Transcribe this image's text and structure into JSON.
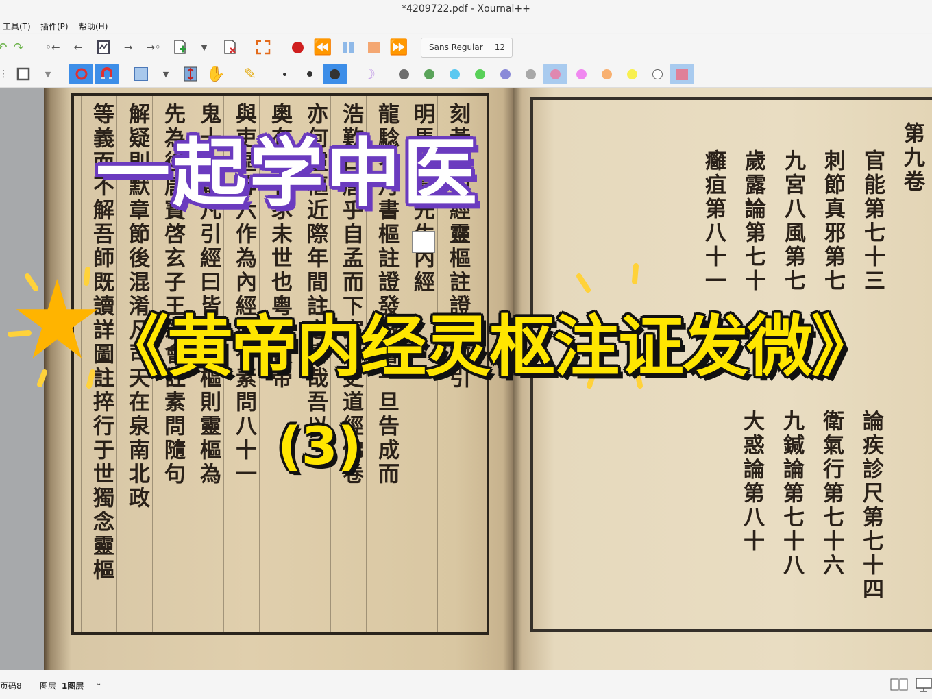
{
  "window": {
    "title": "*4209722.pdf - Xournal++"
  },
  "menu": {
    "tools": "工具(T)",
    "plugins": "插件(P)",
    "help": "帮助(H)"
  },
  "toolbar": {
    "font_name": "Sans Regular",
    "font_size": "12"
  },
  "palette": {
    "colors": [
      "#6e6e6e",
      "#5aa35a",
      "#5cc8f0",
      "#58d058",
      "#8a8ad8",
      "#a8a8a8",
      "#e088b0",
      "#f088f0",
      "#f8b070",
      "#f8f050",
      "#ffffff",
      "#e08098"
    ]
  },
  "overlay": {
    "title": "一起学中医",
    "book": "《黄帝内经灵枢注证发微》",
    "part": "(3)"
  },
  "scan_left": {
    "columns": [
      "刻黃帝內經靈樞註證發微引",
      "明馬玄臺先生內經",
      "龍騐名丹書樞註證發微書一旦告成而",
      "浩歎曰唐乎自孟而下家子史道經佛卷",
      "亦何靈樞近際年間註之書哉吾以",
      "奧有志者豕未世也粵稽黃帝",
      "與吏區等六作為內經內有素問八十一",
      "鬼十一篇凡引經曰皆出靈樞則靈樞為",
      "先為後唐寶啓玄子王氷會註素問隨句",
      "解疑則默章節後混淆凡司天在泉南北政",
      "等義而不解吾師既讀詳圖註捽行于世獨念靈樞"
    ]
  },
  "scan_right": {
    "columns": [
      "第九卷",
      "官能第七十三",
      "刺節真邪第七",
      "九宮八風第七",
      "歲露論第七十",
      "癰疽第八十一",
      "論疾診尺第七十四",
      "衛氣行第七十六",
      "九鍼論第七十八",
      "大惑論第八十"
    ]
  },
  "status": {
    "page_label": "页码8",
    "layer_label": "图层",
    "layer_value": "1图层"
  }
}
